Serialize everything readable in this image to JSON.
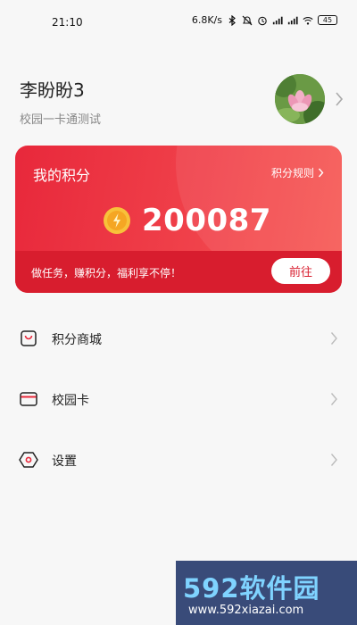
{
  "status_bar": {
    "time": "21:10",
    "network_speed": "6.8K/s",
    "battery": "45",
    "icons": [
      "bluetooth-icon",
      "mute-icon",
      "alarm-icon",
      "signal-icon",
      "signal-icon",
      "wifi-icon",
      "battery-icon"
    ]
  },
  "profile": {
    "name": "李盼盼3",
    "subtitle": "校园一卡通测试"
  },
  "points_card": {
    "title": "我的积分",
    "rule_link": "积分规则",
    "points": "200087",
    "slogan": "做任务，赚积分，福利享不停！",
    "go_button": "前往",
    "colors": {
      "card": "#e8283b",
      "footer": "#d81d2e",
      "coin": "#f5a623"
    }
  },
  "menu": {
    "items": [
      {
        "label": "积分商城",
        "icon": "shopping-bag-icon"
      },
      {
        "label": "校园卡",
        "icon": "card-icon"
      },
      {
        "label": "设置",
        "icon": "settings-hexagon-icon"
      }
    ]
  },
  "watermark": {
    "logo": "592软件园",
    "url": "www.592xiazai.com"
  }
}
